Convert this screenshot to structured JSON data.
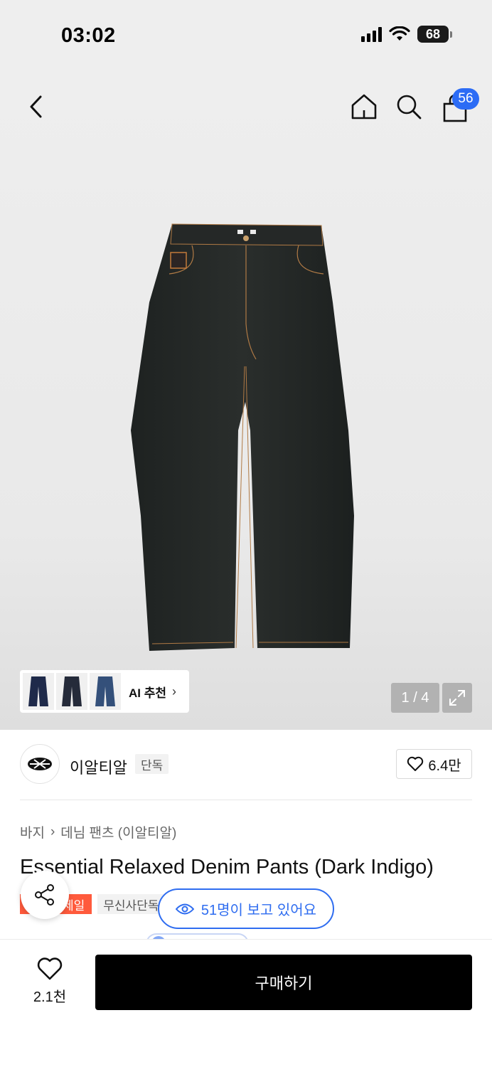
{
  "status_bar": {
    "time": "03:02",
    "battery": "68"
  },
  "header": {
    "cart_count": "56"
  },
  "gallery": {
    "ai_label": "AI 추천",
    "page_indicator": "1 / 4"
  },
  "brand": {
    "name": "이알티알",
    "exclusive_tag": "단독",
    "like_count": "6.4만"
  },
  "breadcrumb": {
    "category": "바지",
    "subcategory": "데님 팬츠 (이알티알)"
  },
  "product": {
    "title": "Essential Relaxed Denim Pants (Dark Indigo)",
    "sale_tag": "세일",
    "exclusive_tag": "무신사단독"
  },
  "viewers": {
    "text": "51명이 보고 있어요"
  },
  "bottom_bar": {
    "wish_count": "2.1천",
    "buy_label": "구매하기"
  },
  "colors": {
    "accent_blue": "#2f6df0",
    "sale_red": "#ff5a3c",
    "buy_black": "#000000"
  }
}
